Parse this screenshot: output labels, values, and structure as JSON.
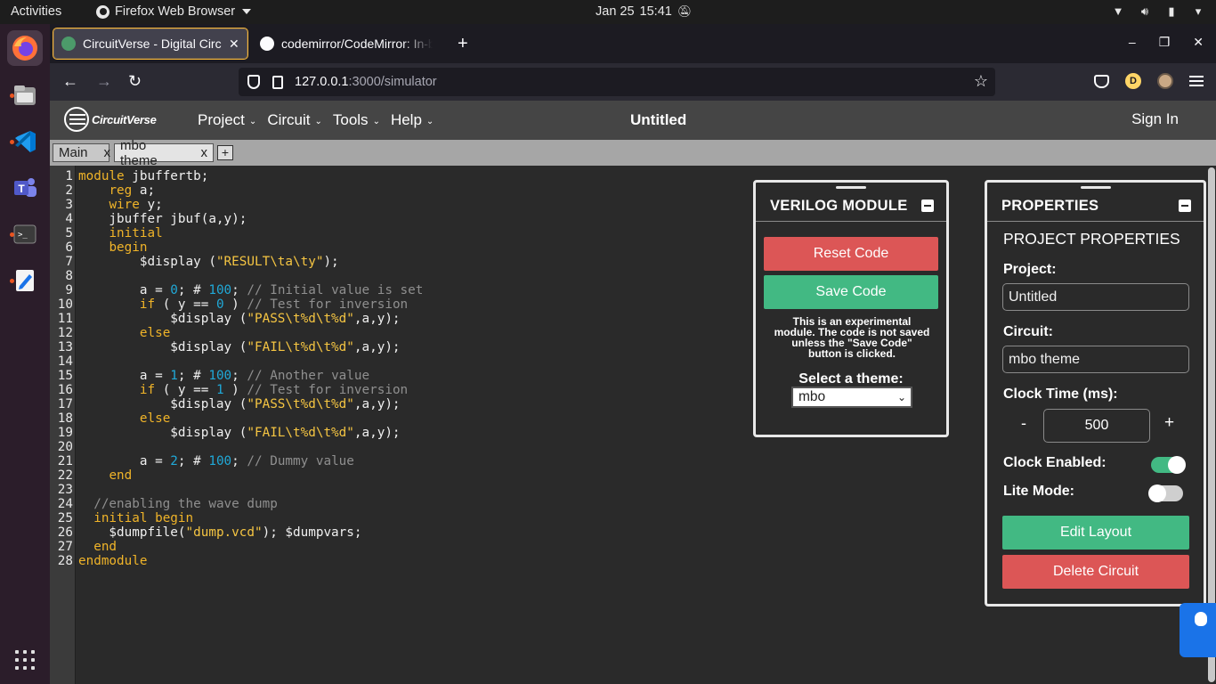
{
  "system": {
    "activities": "Activities",
    "app_name": "Firefox Web Browser",
    "date": "Jan 25",
    "time": "15:41"
  },
  "browser": {
    "tabs": [
      {
        "title": "CircuitVerse - Digital Circuit Simulator online",
        "active": true
      },
      {
        "title": "codemirror/CodeMirror: In-browser code editor",
        "active": false
      }
    ],
    "url_host": "127.0.0.1",
    "url_path": ":3000/simulator",
    "profile_initial": "D"
  },
  "cv_nav": {
    "logo_text": "CircuitVerse",
    "menus": [
      "Project",
      "Circuit",
      "Tools",
      "Help"
    ],
    "project_title": "Untitled",
    "sign_in": "Sign In"
  },
  "circuit_tabs": [
    {
      "label": "Main",
      "close": "x"
    },
    {
      "label": "mbo theme",
      "close": "x"
    }
  ],
  "code_lines": [
    "module jbuffertb;",
    "    reg a;",
    "    wire y;",
    "    jbuffer jbuf(a,y);",
    "    initial",
    "    begin",
    "        $display (\"RESULT\\ta\\ty\");",
    "",
    "        a = 0; # 100; // Initial value is set",
    "        if ( y == 0 ) // Test for inversion",
    "            $display (\"PASS\\t%d\\t%d\",a,y);",
    "        else",
    "            $display (\"FAIL\\t%d\\t%d\",a,y);",
    "",
    "        a = 1; # 100; // Another value",
    "        if ( y == 1 ) // Test for inversion",
    "            $display (\"PASS\\t%d\\t%d\",a,y);",
    "        else",
    "            $display (\"FAIL\\t%d\\t%d\",a,y);",
    "",
    "        a = 2; # 100; // Dummy value",
    "    end",
    "",
    "  //enabling the wave dump",
    "  initial begin",
    "    $dumpfile(\"dump.vcd\"); $dumpvars;",
    "  end",
    "endmodule"
  ],
  "verilog_panel": {
    "title": "VERILOG MODULE",
    "reset_label": "Reset Code",
    "save_label": "Save Code",
    "note": "This is an experimental module. The code is not saved unless the \"Save Code\" button is clicked.",
    "theme_label": "Select a theme:",
    "theme_value": "mbo"
  },
  "properties_panel": {
    "title": "PROPERTIES",
    "subtitle": "PROJECT PROPERTIES",
    "project_label": "Project:",
    "project_value": "Untitled",
    "circuit_label": "Circuit:",
    "circuit_value": "mbo theme",
    "clock_time_label": "Clock Time (ms):",
    "clock_minus": "-",
    "clock_value": "500",
    "clock_plus": "+",
    "clock_enabled_label": "Clock Enabled:",
    "clock_enabled": true,
    "lite_mode_label": "Lite Mode:",
    "lite_mode": false,
    "edit_layout_label": "Edit Layout",
    "delete_circuit_label": "Delete Circuit"
  },
  "colors": {
    "accent_green": "#42b983",
    "accent_red": "#dc5656",
    "keyword": "#f0b429",
    "number": "#20a9d8",
    "comment": "#8f8f8f"
  }
}
